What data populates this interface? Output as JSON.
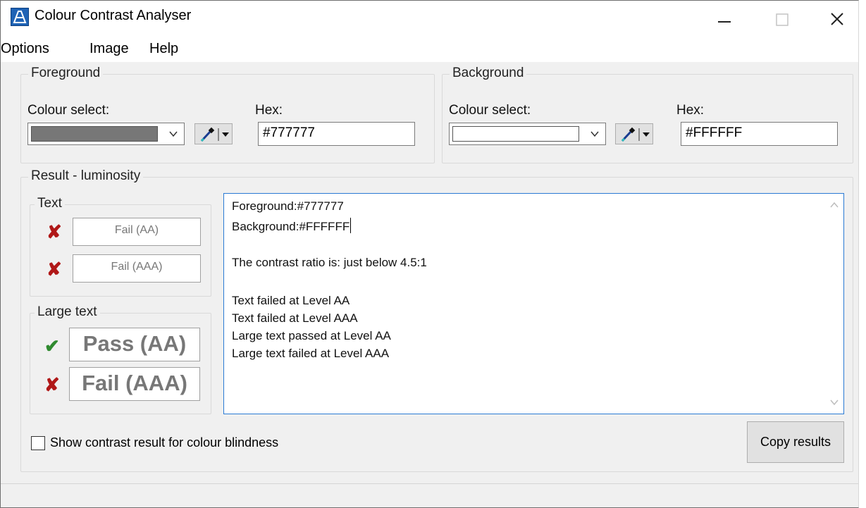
{
  "window": {
    "title": "Colour Contrast Analyser",
    "controls": [
      "minimize-icon",
      "maximize-icon",
      "close-icon"
    ]
  },
  "menu": [
    "Options",
    "Image",
    "Help"
  ],
  "foreground": {
    "group_label": "Foreground",
    "colour_select_label": "Colour select:",
    "hex_label": "Hex:",
    "hex_value": "#777777",
    "swatch_color": "#777777"
  },
  "background": {
    "group_label": "Background",
    "colour_select_label": "Colour select:",
    "hex_label": "Hex:",
    "hex_value": "#FFFFFF",
    "swatch_color": "#FFFFFF"
  },
  "result": {
    "group_label": "Result - luminosity",
    "text_group": {
      "label": "Text",
      "aa": {
        "status": "fail",
        "label": "Fail (AA)"
      },
      "aaa": {
        "status": "fail",
        "label": "Fail (AAA)"
      }
    },
    "large_text_group": {
      "label": "Large text",
      "aa": {
        "status": "pass",
        "label": "Pass (AA)"
      },
      "aaa": {
        "status": "fail",
        "label": "Fail (AAA)"
      }
    },
    "details": {
      "foreground": "Foreground:#777777",
      "background": "Background:#FFFFFF",
      "ratio": "The contrast ratio is: just below 4.5:1",
      "lines": [
        "Text failed at Level AA",
        "Text failed at Level AAA",
        "Large text passed at Level AA",
        "Large text failed at Level AAA"
      ]
    }
  },
  "colour_blindness_checkbox": {
    "label": "Show contrast result for colour blindness",
    "checked": false
  },
  "copy_button": "Copy results",
  "colors": {
    "fail": "#b01818",
    "pass": "#2f8a2f",
    "focus_border": "#2a7ad4",
    "icon": "#1f63b5"
  }
}
